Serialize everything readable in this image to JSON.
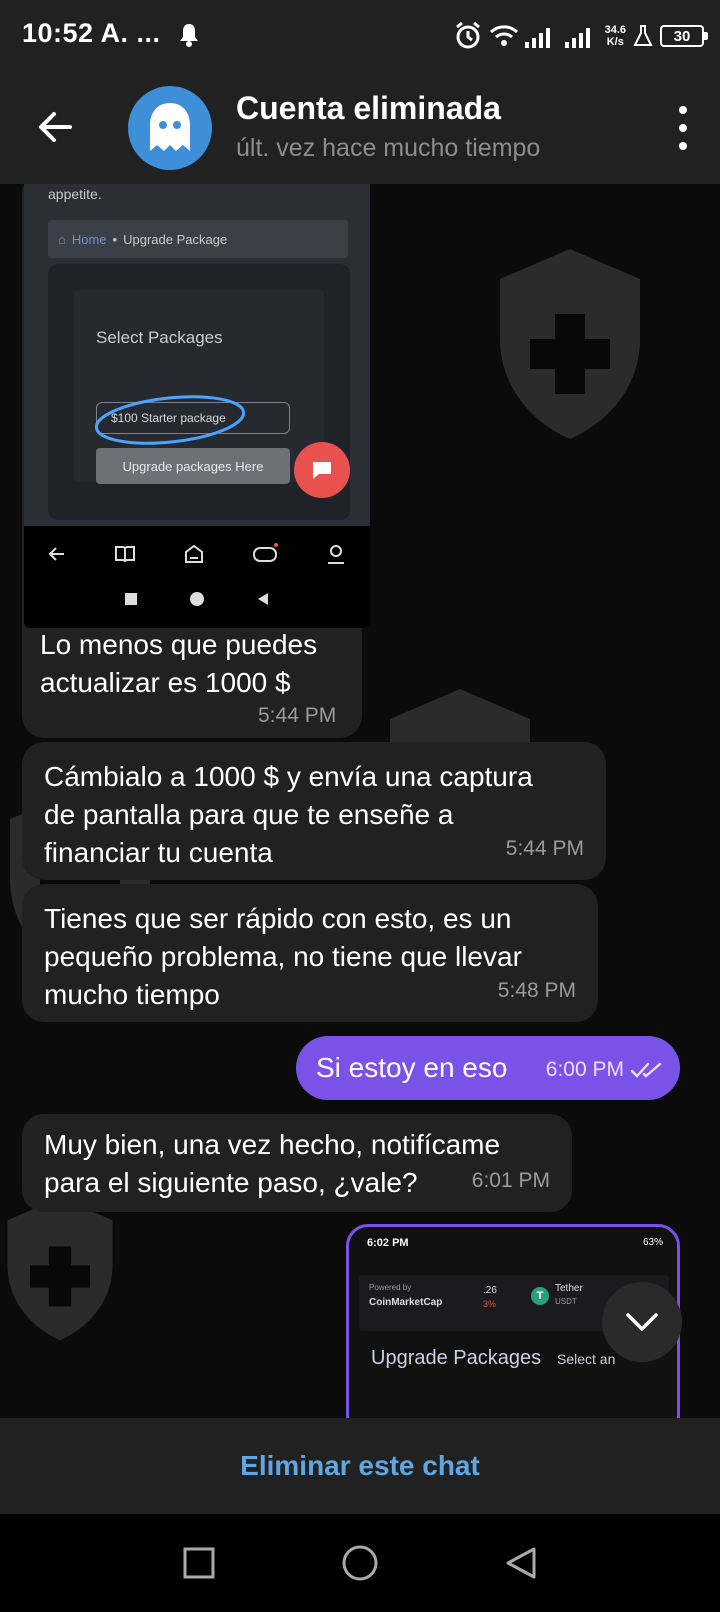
{
  "status_bar": {
    "time": "10:52 A. ...",
    "net_speed_value": "34.6",
    "net_speed_unit": "K/s",
    "battery": "30"
  },
  "header": {
    "title": "Cuenta eliminada",
    "subtitle": "últ. vez hace mucho tiempo"
  },
  "embedded_screenshot": {
    "appetite": "appetite.",
    "crumb_home": "Home",
    "crumb_sep": "•",
    "crumb_current": "Upgrade Package",
    "select_title": "Select Packages",
    "select_value": "$100 Starter package",
    "upgrade_button": "Upgrade packages Here"
  },
  "messages": [
    {
      "direction": "in",
      "text_lines": [
        "Lo menos que puedes",
        "actualizar es 1000 $"
      ],
      "time": "5:44 PM"
    },
    {
      "direction": "in",
      "text_lines": [
        "Cámbialo a 1000 $ y envía una captura",
        "de pantalla para que te enseñe a",
        "financiar tu cuenta"
      ],
      "time": "5:44 PM"
    },
    {
      "direction": "in",
      "text_lines": [
        "Tienes que ser rápido con esto, es un",
        "pequeño problema, no tiene que llevar",
        "mucho tiempo"
      ],
      "time": "5:48 PM"
    },
    {
      "direction": "out",
      "text_lines": [
        "Si estoy en eso"
      ],
      "time": "6:00 PM",
      "status": "read"
    },
    {
      "direction": "in",
      "text_lines": [
        "Muy bien, una vez hecho, notifícame",
        "para el siguiente paso, ¿vale?"
      ],
      "time": "6:01 PM"
    }
  ],
  "preview_screenshot": {
    "time": "6:02 PM",
    "battery": "63",
    "powered_by": "Powered by",
    "provider": "CoinMarketCap",
    "price_fragment": ".26",
    "change_fragment": "3%",
    "coin_name": "Tether",
    "coin_symbol": "USDT",
    "coin_letter": "T",
    "heading": "Upgrade Packages",
    "sub": "Select an"
  },
  "footer": {
    "delete_label": "Eliminar este chat"
  },
  "colors": {
    "bar_bg": "#212121",
    "bubble_in": "#212121",
    "bubble_out": "#7b52e8",
    "accent_link": "#5fa6e2",
    "avatar": "#3e8ed8"
  }
}
